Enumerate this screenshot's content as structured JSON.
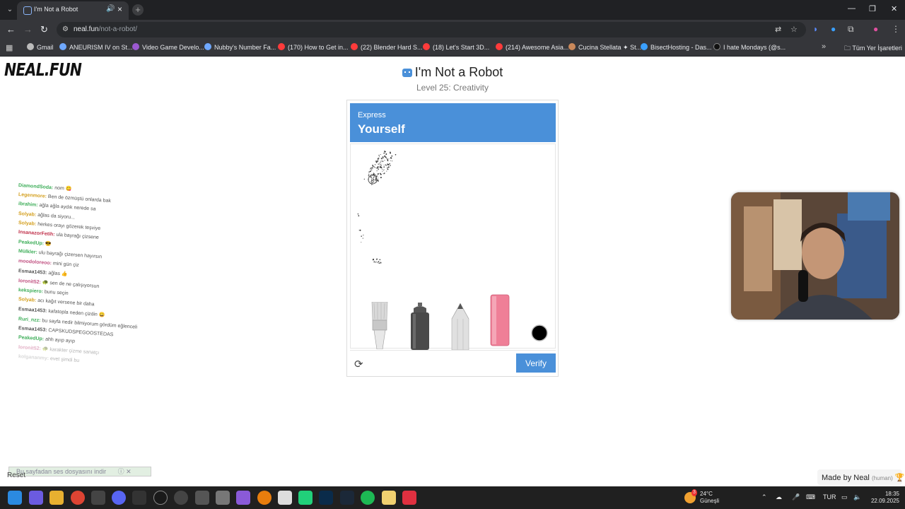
{
  "browser": {
    "tab_title": "I'm Not a Robot",
    "url_domain": "neal.fun",
    "url_path": "/not-a-robot/",
    "bookmarks": [
      {
        "label": "Gmail",
        "color": "#bbbbbb"
      },
      {
        "label": "ANEURISM IV on St...",
        "color": "#6fa8ff"
      },
      {
        "label": "Video Game Develo...",
        "color": "#9b59d0"
      },
      {
        "label": "Nubby's Number Fa...",
        "color": "#6fa8ff"
      },
      {
        "label": "(170) How to Get in...",
        "color": "#ff3b3b"
      },
      {
        "label": "(22) Blender Hard S...",
        "color": "#ff3b3b"
      },
      {
        "label": "(18) Let's Start 3D...",
        "color": "#ff3b3b"
      },
      {
        "label": "(214) Awesome Asia...",
        "color": "#ff3b3b"
      },
      {
        "label": "Cucina Stellata ✦ St...",
        "color": "#c9885a"
      },
      {
        "label": "BisectHosting - Das...",
        "color": "#3aa0ff"
      },
      {
        "label": "I hate Mondays (@s...",
        "color": "#111111"
      }
    ],
    "bookmarks_folder": "Tüm Yer İşaretleri"
  },
  "page": {
    "logo": "NEAL.FUN",
    "title": "I'm Not a Robot",
    "level": "Level 25: Creativity",
    "captcha": {
      "header_small": "Express",
      "header_big": "Yourself",
      "verify_label": "Verify",
      "tools": [
        "paintbrush",
        "spray-can",
        "pencil",
        "eraser",
        "color-picker"
      ],
      "selected_color": "#000000",
      "accent": "#4a90d9"
    },
    "reset_label": "Reset",
    "made_by": "Made by Neal",
    "made_by_sub": "(human)"
  },
  "overlays": {
    "download_prompt": "Bu sayfadan ses dosyasını indir",
    "chat": [
      {
        "user": "DiamondSoda:",
        "msg": "nom 😋",
        "color": "#3fae5a"
      },
      {
        "user": "Legenmore:",
        "msg": "Ben de özmüştü onlarda bak",
        "color": "#d4a020"
      },
      {
        "user": "ibrahim:",
        "msg": "ağla ağla aydık nerede sa",
        "color": "#3fae5a"
      },
      {
        "user": "Solyab:",
        "msg": "ağlas da siyoru...",
        "color": "#d4a020"
      },
      {
        "user": "Solyab:",
        "msg": "herkes orayı gözerek teşviye",
        "color": "#d4a020"
      },
      {
        "user": "InsanazorFetih:",
        "msg": "ula bayrağı çizsene",
        "color": "#c0304a"
      },
      {
        "user": "PeakedUp:",
        "msg": "😎",
        "color": "#3fae5a"
      },
      {
        "user": "Mülkler:",
        "msg": "ulu bayrağı çizersen hayırsın",
        "color": "#3fae5a"
      },
      {
        "user": "moodoloreoo:",
        "msg": "mini gün çiz",
        "color": "#c05080"
      },
      {
        "user": "Esmaa1453:",
        "msg": "ağlas 👍",
        "color": "#555555"
      },
      {
        "user": "loronit52:",
        "msg": "🐢 sen de ne çalışıyorsun",
        "color": "#c05080"
      },
      {
        "user": "kekspiero:",
        "msg": "bunu seçin",
        "color": "#3fae5a"
      },
      {
        "user": "Solyab:",
        "msg": "acı kağıt versene bir daha",
        "color": "#d4a020"
      },
      {
        "user": "Esmaa1453:",
        "msg": "kafatopla neden çizdin 😀",
        "color": "#555555"
      },
      {
        "user": "Ruri_nzz:",
        "msg": "bu sayfa nedir bilmiyorum gördüm eğlenceli",
        "color": "#3fae5a"
      },
      {
        "user": "Esmaa1453:",
        "msg": "CAPSKUDSPEGOOSTEDAS",
        "color": "#555555"
      },
      {
        "user": "PeakedUp:",
        "msg": "ahh ayıp ayıp",
        "color": "#3fae5a"
      },
      {
        "user": "loronit52:",
        "msg": "🐢 karakter çizme sanatçı",
        "color": "#c05080"
      },
      {
        "user": "kolgananmy:",
        "msg": "evet şimdi bu",
        "color": "#aaaaaa"
      }
    ]
  },
  "taskbar": {
    "weather_temp": "24°C",
    "weather_desc": "Güneşli",
    "weather_badge": "3",
    "lang": "TUR",
    "time": "18:35",
    "date": "22.09.2025"
  }
}
